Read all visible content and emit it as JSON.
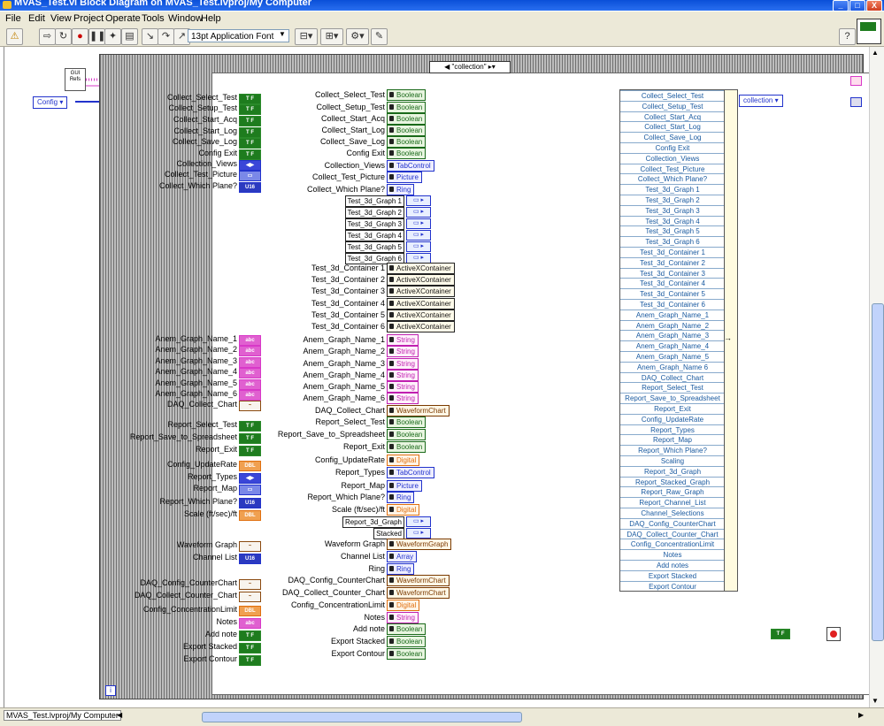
{
  "window": {
    "title": "MVAS_Test.vi Block Diagram on MVAS_Test.lvproj/My Computer",
    "controls": [
      "_",
      "□",
      "X"
    ]
  },
  "menu": [
    "File",
    "Edit",
    "View",
    "Project",
    "Operate",
    "Tools",
    "Window",
    "Help"
  ],
  "toolbar": {
    "font": "13pt Application Font",
    "help_label": "?"
  },
  "diagram": {
    "case_selector": "\"collection\"",
    "gui_refs_label": "GUI Refs",
    "config_enum": "Config",
    "collection_enum": "collection",
    "true_constant": "T F",
    "info_label": "i"
  },
  "left_terminals": [
    {
      "label": "Collect_Select_Test",
      "type": "bool",
      "tag": "T F"
    },
    {
      "label": "Collect_Setup_Test",
      "type": "bool",
      "tag": "T F"
    },
    {
      "label": "Collect_Start_Acq",
      "type": "bool",
      "tag": "T F"
    },
    {
      "label": "Collect_Start_Log",
      "type": "bool",
      "tag": "T F"
    },
    {
      "label": "Collect_Save_Log",
      "type": "bool",
      "tag": "T F"
    },
    {
      "label": "Config Exit",
      "type": "bool",
      "tag": "T F"
    },
    {
      "label": "Collection_Views",
      "type": "enum",
      "tag": "◀▶"
    },
    {
      "label": "Collect_Test_Picture",
      "type": "pic",
      "tag": "▭"
    },
    {
      "label": "Collect_Which Plane?",
      "type": "u16",
      "tag": "U16"
    },
    {
      "label": "Anem_Graph_Name_1",
      "type": "str",
      "tag": "abc"
    },
    {
      "label": "Anem_Graph_Name_2",
      "type": "str",
      "tag": "abc"
    },
    {
      "label": "Anem_Graph_Name_3",
      "type": "str",
      "tag": "abc"
    },
    {
      "label": "Anem_Graph_Name_4",
      "type": "str",
      "tag": "abc"
    },
    {
      "label": "Anem_Graph_Name_5",
      "type": "str",
      "tag": "abc"
    },
    {
      "label": "Anem_Graph_Name_6",
      "type": "str",
      "tag": "abc"
    },
    {
      "label": "DAQ_Collect_Chart",
      "type": "wave",
      "tag": "~"
    },
    {
      "label": "Report_Select_Test",
      "type": "bool",
      "tag": "T F"
    },
    {
      "label": "Report_Save_to_Spreadsheet",
      "type": "bool",
      "tag": "T F"
    },
    {
      "label": "Report_Exit",
      "type": "bool",
      "tag": "T F"
    },
    {
      "label": "Config_UpdateRate",
      "type": "dbl",
      "tag": "DBL"
    },
    {
      "label": "Report_Types",
      "type": "enum",
      "tag": "◀▶"
    },
    {
      "label": "Report_Map",
      "type": "pic",
      "tag": "▭"
    },
    {
      "label": "Report_Which Plane?",
      "type": "u16",
      "tag": "U16"
    },
    {
      "label": "Scale (ft/sec)/ft",
      "type": "dbl",
      "tag": "DBL"
    },
    {
      "label": "Waveform Graph",
      "type": "wave",
      "tag": "~"
    },
    {
      "label": "Channel List",
      "type": "u16",
      "tag": "U16"
    },
    {
      "label": "DAQ_Config_CounterChart",
      "type": "wave",
      "tag": "~"
    },
    {
      "label": "DAQ_Collect_Counter_Chart",
      "type": "wave",
      "tag": "~"
    },
    {
      "label": "Config_ConcentrationLimit",
      "type": "dbl",
      "tag": "DBL"
    },
    {
      "label": "Notes",
      "type": "str",
      "tag": "abc"
    },
    {
      "label": "Add note",
      "type": "bool",
      "tag": "T F"
    },
    {
      "label": "Export Stacked",
      "type": "bool",
      "tag": "T F"
    },
    {
      "label": "Export Contour",
      "type": "bool",
      "tag": "T F"
    }
  ],
  "references": [
    {
      "label": "Collect_Select_Test",
      "ref": "Boolean",
      "kind": "green"
    },
    {
      "label": "Collect_Setup_Test",
      "ref": "Boolean",
      "kind": "green"
    },
    {
      "label": "Collect_Start_Acq",
      "ref": "Boolean",
      "kind": "green"
    },
    {
      "label": "Collect_Start_Log",
      "ref": "Boolean",
      "kind": "green"
    },
    {
      "label": "Collect_Save_Log",
      "ref": "Boolean",
      "kind": "green"
    },
    {
      "label": "Config Exit",
      "ref": "Boolean",
      "kind": "green"
    },
    {
      "label": "Collection_Views",
      "ref": "TabControl",
      "kind": "blue"
    },
    {
      "label": "Collect_Test_Picture",
      "ref": "Picture",
      "kind": "blue"
    },
    {
      "label": "Collect_Which Plane?",
      "ref": "Ring",
      "kind": "blue"
    },
    {
      "label": "Test_3d_Graph 1",
      "ref": "",
      "kind": "graph"
    },
    {
      "label": "Test_3d_Graph 2",
      "ref": "",
      "kind": "graph"
    },
    {
      "label": "Test_3d_Graph 3",
      "ref": "",
      "kind": "graph"
    },
    {
      "label": "Test_3d_Graph 4",
      "ref": "",
      "kind": "graph"
    },
    {
      "label": "Test_3d_Graph 5",
      "ref": "",
      "kind": "graph"
    },
    {
      "label": "Test_3d_Graph 6",
      "ref": "",
      "kind": "graph"
    },
    {
      "label": "Test_3d_Container 1",
      "ref": "ActiveXContainer",
      "kind": "black"
    },
    {
      "label": "Test_3d_Container 2",
      "ref": "ActiveXContainer",
      "kind": "black"
    },
    {
      "label": "Test_3d_Container 3",
      "ref": "ActiveXContainer",
      "kind": "black"
    },
    {
      "label": "Test_3d_Container 4",
      "ref": "ActiveXContainer",
      "kind": "black"
    },
    {
      "label": "Test_3d_Container 5",
      "ref": "ActiveXContainer",
      "kind": "black"
    },
    {
      "label": "Test_3d_Container 6",
      "ref": "ActiveXContainer",
      "kind": "black"
    },
    {
      "label": "Anem_Graph_Name_1",
      "ref": "String",
      "kind": "pink"
    },
    {
      "label": "Anem_Graph_Name_2",
      "ref": "String",
      "kind": "pink"
    },
    {
      "label": "Anem_Graph_Name_3",
      "ref": "String",
      "kind": "pink"
    },
    {
      "label": "Anem_Graph_Name_4",
      "ref": "String",
      "kind": "pink"
    },
    {
      "label": "Anem_Graph_Name_5",
      "ref": "String",
      "kind": "pink"
    },
    {
      "label": "Anem_Graph_Name_6",
      "ref": "String",
      "kind": "pink"
    },
    {
      "label": "DAQ_Collect_Chart",
      "ref": "WaveformChart",
      "kind": "brown"
    },
    {
      "label": "Report_Select_Test",
      "ref": "Boolean",
      "kind": "green"
    },
    {
      "label": "Report_Save_to_Spreadsheet",
      "ref": "Boolean",
      "kind": "green"
    },
    {
      "label": "Report_Exit",
      "ref": "Boolean",
      "kind": "green"
    },
    {
      "label": "Config_UpdateRate",
      "ref": "Digital",
      "kind": "orange"
    },
    {
      "label": "Report_Types",
      "ref": "TabControl",
      "kind": "blue"
    },
    {
      "label": "Report_Map",
      "ref": "Picture",
      "kind": "blue"
    },
    {
      "label": "Report_Which Plane?",
      "ref": "Ring",
      "kind": "blue"
    },
    {
      "label": "Scale (ft/sec)/ft",
      "ref": "Digital",
      "kind": "orange"
    },
    {
      "label": "Report_3d_Graph",
      "ref": "",
      "kind": "graph"
    },
    {
      "label": "Stacked",
      "ref": "",
      "kind": "graph"
    },
    {
      "label": "Waveform Graph",
      "ref": "WaveformGraph",
      "kind": "brown"
    },
    {
      "label": "Channel List",
      "ref": "Array",
      "kind": "blue"
    },
    {
      "label": "Ring",
      "ref": "Ring",
      "kind": "blue"
    },
    {
      "label": "DAQ_Config_CounterChart",
      "ref": "WaveformChart",
      "kind": "brown"
    },
    {
      "label": "DAQ_Collect_Counter_Chart",
      "ref": "WaveformChart",
      "kind": "brown"
    },
    {
      "label": "Config_ConcentrationLimit",
      "ref": "Digital",
      "kind": "orange"
    },
    {
      "label": "Notes",
      "ref": "String",
      "kind": "pink"
    },
    {
      "label": "Add note",
      "ref": "Boolean",
      "kind": "green"
    },
    {
      "label": "Export Stacked",
      "ref": "Boolean",
      "kind": "green"
    },
    {
      "label": "Export Contour",
      "ref": "Boolean",
      "kind": "green"
    }
  ],
  "bundle_items": [
    "Collect_Select_Test",
    "Collect_Setup_Test",
    "Collect_Start_Acq",
    "Collect_Start_Log",
    "Collect_Save_Log",
    "Config Exit",
    "Collection_Views",
    "Collect_Test_Picture",
    "Collect_Which Plane?",
    "Test_3d_Graph 1",
    "Test_3d_Graph 2",
    "Test_3d_Graph 3",
    "Test_3d_Graph 4",
    "Test_3d_Graph 5",
    "Test_3d_Graph 6",
    "Test_3d_Container 1",
    "Test_3d_Container 2",
    "Test_3d_Container 3",
    "Test_3d_Container 4",
    "Test_3d_Container 5",
    "Test_3d_Container 6",
    "Anem_Graph_Name_1",
    "Anem_Graph_Name_2",
    "Anem_Graph_Name_3",
    "Anem_Graph_Name_4",
    "Anem_Graph_Name_5",
    "Anem_Graph_Name 6",
    "DAQ_Collect_Chart",
    "Report_Select_Test",
    "Report_Save_to_Spreadsheet",
    "Report_Exit",
    "Config_UpdateRate",
    "Report_Types",
    "Report_Map",
    "Report_Which Plane?",
    "Scaling",
    "Report_3d_Graph",
    "Report_Stacked_Graph",
    "Report_Raw_Graph",
    "Report_Channel_List",
    "Channel_Selections",
    "DAQ_Config_CounterChart",
    "DAQ_Collect_Counter_Chart",
    "Config_ConcentrationLimit",
    "Notes",
    "Add notes",
    "Export Stacked",
    "Export Contour"
  ],
  "status": {
    "project": "MVAS_Test.lvproj/My Computer"
  },
  "colors": {
    "titlebar": "#0a4fd8",
    "bool_green": "#1e7c1e",
    "ref_blue": "#2233cc",
    "string_pink": "#e060d0",
    "numeric_orange": "#f0a050",
    "cluster_wire": "#d838c8"
  }
}
